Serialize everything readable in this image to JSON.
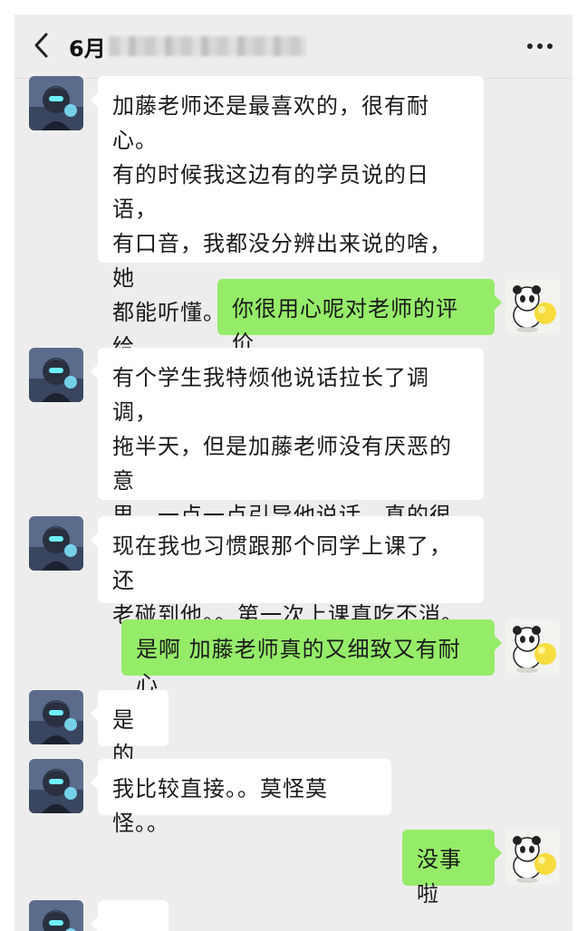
{
  "header": {
    "title": "6月",
    "back_icon": "chevron-left-icon",
    "more_icon": "ellipsis-icon"
  },
  "messages": [
    {
      "side": "left",
      "text": "加藤老师还是最喜欢的，很有耐心。\n有的时候我这边有的学员说的日语，\n有口音，我都没分辨出来说的啥，她\n都能听懂。真厉害。给每个同学都给\n予中肯的评价，很认真。"
    },
    {
      "side": "right",
      "text": "你很用心呢对老师的评价"
    },
    {
      "side": "left",
      "text": "有个学生我特烦他说话拉长了调调，\n拖半天，但是加藤老师没有厌恶的意\n思，一点一点引导他说话。真的很了\n不起。"
    },
    {
      "side": "left",
      "text": "现在我也习惯跟那个同学上课了，还\n老碰到他。。第一次上课真吃不消。"
    },
    {
      "side": "right",
      "text": "是啊 加藤老师真的又细致又有耐心"
    },
    {
      "side": "left",
      "text": "是的"
    },
    {
      "side": "left",
      "text": "我比较直接。。莫怪莫怪。。"
    },
    {
      "side": "right",
      "text": "没事啦"
    },
    {
      "side": "left",
      "text": ""
    }
  ],
  "colors": {
    "background": "#ededed",
    "bubble_self": "#95ec69",
    "bubble_other": "#ffffff"
  }
}
